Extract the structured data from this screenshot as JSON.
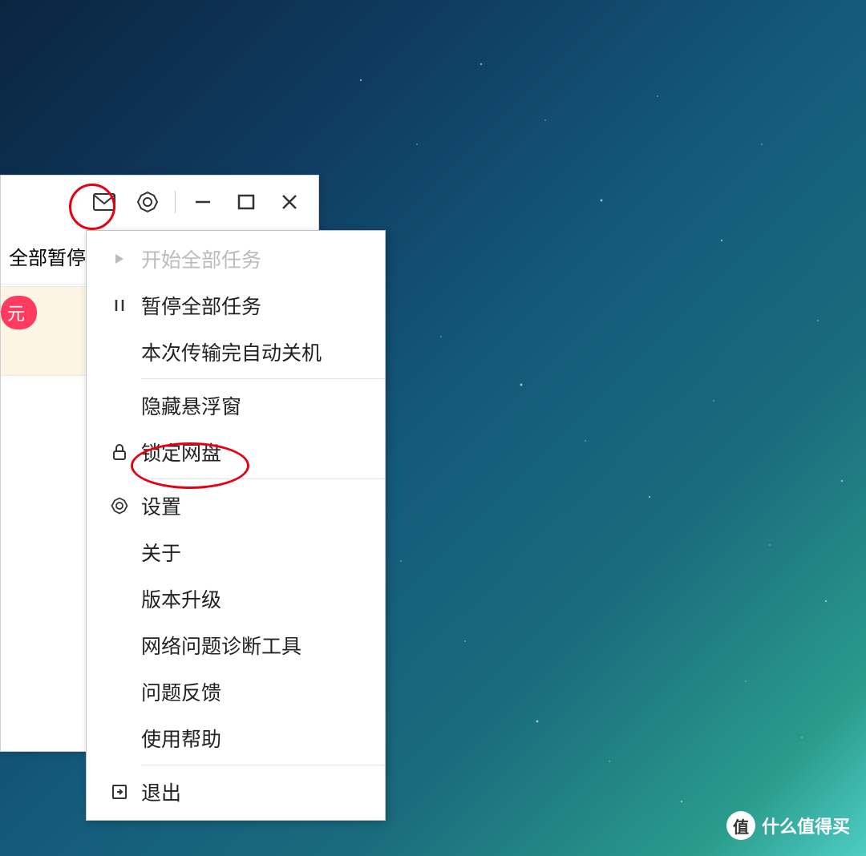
{
  "titlebar": {
    "icons": {
      "mail": "mail-icon",
      "gear": "gear-icon",
      "minimize": "minimize-icon",
      "maximize": "maximize-icon",
      "close": "close-icon"
    }
  },
  "toolbar": {
    "pause_all_label": "全部暂停"
  },
  "promo": {
    "badge_text": "元"
  },
  "menu": {
    "items": [
      {
        "label": "开始全部任务",
        "icon": "play-icon",
        "disabled": true
      },
      {
        "label": "暂停全部任务",
        "icon": "pause-icon",
        "disabled": false
      },
      {
        "label": "本次传输完自动关机",
        "icon": "",
        "disabled": false
      }
    ],
    "group2": [
      {
        "label": "隐藏悬浮窗",
        "icon": "",
        "disabled": false
      },
      {
        "label": "锁定网盘",
        "icon": "lock-icon",
        "disabled": false
      }
    ],
    "group3": [
      {
        "label": "设置",
        "icon": "gear-icon",
        "disabled": false
      },
      {
        "label": "关于",
        "icon": "",
        "disabled": false
      },
      {
        "label": "版本升级",
        "icon": "",
        "disabled": false
      },
      {
        "label": "网络问题诊断工具",
        "icon": "",
        "disabled": false
      },
      {
        "label": "问题反馈",
        "icon": "",
        "disabled": false
      },
      {
        "label": "使用帮助",
        "icon": "",
        "disabled": false
      }
    ],
    "group4": [
      {
        "label": "退出",
        "icon": "exit-icon",
        "disabled": false
      }
    ]
  },
  "annotations": {
    "circle_gear": true,
    "ellipse_settings": true
  },
  "watermark": {
    "badge": "值",
    "text": "什么值得买"
  }
}
